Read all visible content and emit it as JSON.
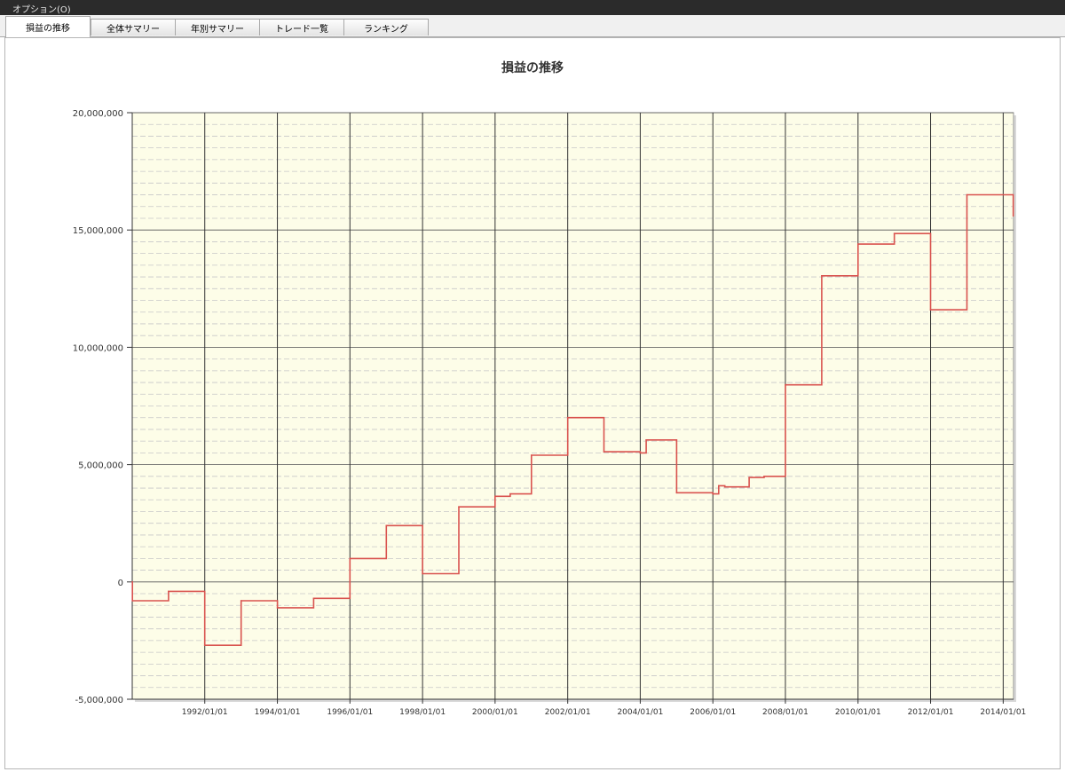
{
  "menubar": {
    "title": "オプション(O)"
  },
  "tabs": [
    {
      "label": "損益の推移",
      "active": true
    },
    {
      "label": "全体サマリー",
      "active": false
    },
    {
      "label": "年別サマリー",
      "active": false
    },
    {
      "label": "トレード一覧",
      "active": false
    },
    {
      "label": "ランキング",
      "active": false
    }
  ],
  "chart_data": {
    "type": "line",
    "title": "損益の推移",
    "xlabel": "",
    "ylabel": "",
    "ylim": [
      -5000000,
      20000000
    ],
    "xlim": [
      "1990/01/01",
      "2014/04/15"
    ],
    "y_ticks": [
      -5000000,
      0,
      5000000,
      10000000,
      15000000,
      20000000
    ],
    "y_tick_labels": [
      "-5,000,000",
      "0",
      "5,000,000",
      "10,000,000",
      "15,000,000",
      "20,000,000"
    ],
    "x_ticks": [
      "1992/01/01",
      "1994/01/01",
      "1996/01/01",
      "1998/01/01",
      "2000/01/01",
      "2002/01/01",
      "2004/01/01",
      "2006/01/01",
      "2008/01/01",
      "2010/01/01",
      "2012/01/01",
      "2014/01/01"
    ],
    "grid": true,
    "background_color": "#fdfde8",
    "line_color": "#d9534f",
    "series": [
      {
        "step": true,
        "points": [
          [
            "1990/01/01",
            0
          ],
          [
            "1990/01/03",
            -800000
          ],
          [
            "1991/01/01",
            -400000
          ],
          [
            "1992/01/01",
            -2700000
          ],
          [
            "1993/01/01",
            -800000
          ],
          [
            "1994/01/01",
            -1100000
          ],
          [
            "1995/01/01",
            -700000
          ],
          [
            "1996/01/01",
            1000000
          ],
          [
            "1997/01/01",
            2400000
          ],
          [
            "1998/01/01",
            350000
          ],
          [
            "1999/01/01",
            3200000
          ],
          [
            "2000/01/01",
            3650000
          ],
          [
            "2000/06/01",
            3750000
          ],
          [
            "2001/01/01",
            5400000
          ],
          [
            "2002/01/01",
            7000000
          ],
          [
            "2003/01/01",
            5550000
          ],
          [
            "2004/01/01",
            5500000
          ],
          [
            "2004/03/01",
            6050000
          ],
          [
            "2005/01/01",
            3800000
          ],
          [
            "2006/01/01",
            3750000
          ],
          [
            "2006/03/01",
            4100000
          ],
          [
            "2006/05/01",
            4050000
          ],
          [
            "2007/01/01",
            4450000
          ],
          [
            "2007/06/01",
            4500000
          ],
          [
            "2008/01/01",
            8400000
          ],
          [
            "2009/01/01",
            13050000
          ],
          [
            "2010/01/01",
            14400000
          ],
          [
            "2011/01/01",
            14850000
          ],
          [
            "2012/01/01",
            11600000
          ],
          [
            "2013/01/01",
            16500000
          ],
          [
            "2014/04/10",
            16500000
          ],
          [
            "2014/04/12",
            15600000
          ]
        ]
      }
    ]
  }
}
